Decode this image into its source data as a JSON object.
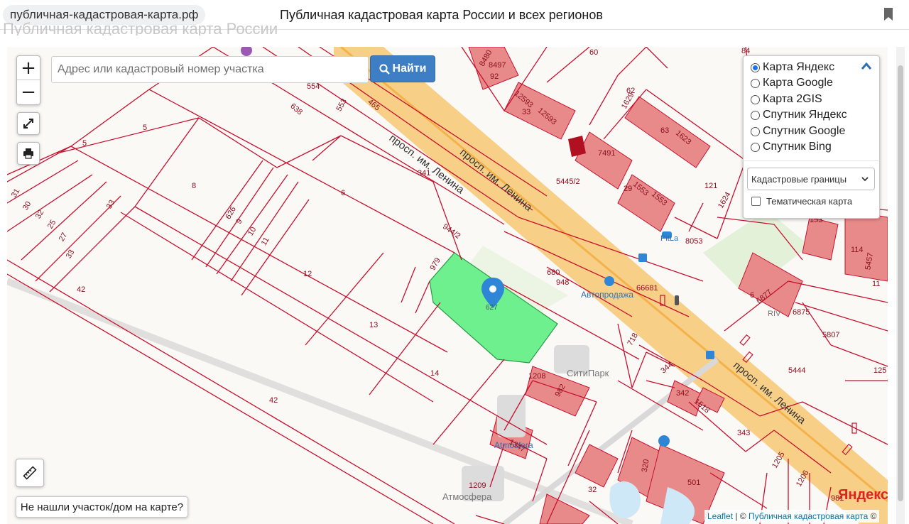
{
  "browser": {
    "url": "публичная-кадастровая-карта.рф",
    "page_title": "Публичная кадастровая карта России и всех регионов",
    "bookmark_icon": "bookmark-icon"
  },
  "ghost_heading": "Публичная кадастровая карта России",
  "search": {
    "placeholder": "Адрес или кадастровый номер участка",
    "button_label": "Найти"
  },
  "zoom": {
    "in_label": "+",
    "out_label": "−"
  },
  "layers": {
    "options": [
      {
        "label": "Карта Яндекс",
        "selected": true
      },
      {
        "label": "Карта Google",
        "selected": false
      },
      {
        "label": "Карта 2GIS",
        "selected": false
      },
      {
        "label": "Спутник Яндекс",
        "selected": false
      },
      {
        "label": "Спутник Google",
        "selected": false
      },
      {
        "label": "Спутник Bing",
        "selected": false
      }
    ],
    "overlay_select": "Кадастровые границы",
    "thematic_label": "Тематическая карта"
  },
  "not_found_button": "Не нашли участок/дом на карте?",
  "attribution": {
    "leaflet": "Leaflet",
    "sep": " | © ",
    "source": "Публичная кадастровая карта",
    "tail": " ©"
  },
  "map_logo": "Яндекс",
  "map_labels": {
    "street_1": "просп. им. Ленина",
    "street_2": "просп. им. Ленина",
    "street_3": "просп. им. Ленина",
    "avto": "Автопродажа",
    "citypark": "СитиПарк",
    "atmosfera_1": "Atmosfera",
    "atmosfera_2": "Атмосфера",
    "pitlane": "PitLa",
    "rivera": "RIV",
    "id_marker": "627"
  },
  "parcel_numbers": [
    "5",
    "5",
    "8",
    "6",
    "341",
    "944/2",
    "979",
    "12",
    "13",
    "14",
    "42",
    "42",
    "626",
    "9",
    "10",
    "11",
    "31",
    "30",
    "32",
    "25",
    "27",
    "33",
    "33",
    "554",
    "553",
    "465",
    "638",
    "8497",
    "92",
    "8480",
    "60",
    "84",
    "12593",
    "12593",
    "33",
    "62",
    "1629",
    "63",
    "1623",
    "7491",
    "29",
    "1553",
    "1553",
    "5445/2",
    "121",
    "1624",
    "8053",
    "114",
    "5457",
    "680",
    "948",
    "66681",
    "718",
    "6",
    "6877",
    "6875",
    "5807",
    "5444",
    "125",
    "1208",
    "982",
    "1347",
    "1209",
    "344",
    "342",
    "1518",
    "343",
    "1205",
    "1206",
    "981",
    "320",
    "501",
    "32",
    "11",
    "153"
  ],
  "colors": {
    "parcel_line": "#c8102e",
    "highlight_fill": "#6ef08e",
    "road": "#f7c873",
    "building": "#e36b6b",
    "accent": "#3d7ec4"
  }
}
